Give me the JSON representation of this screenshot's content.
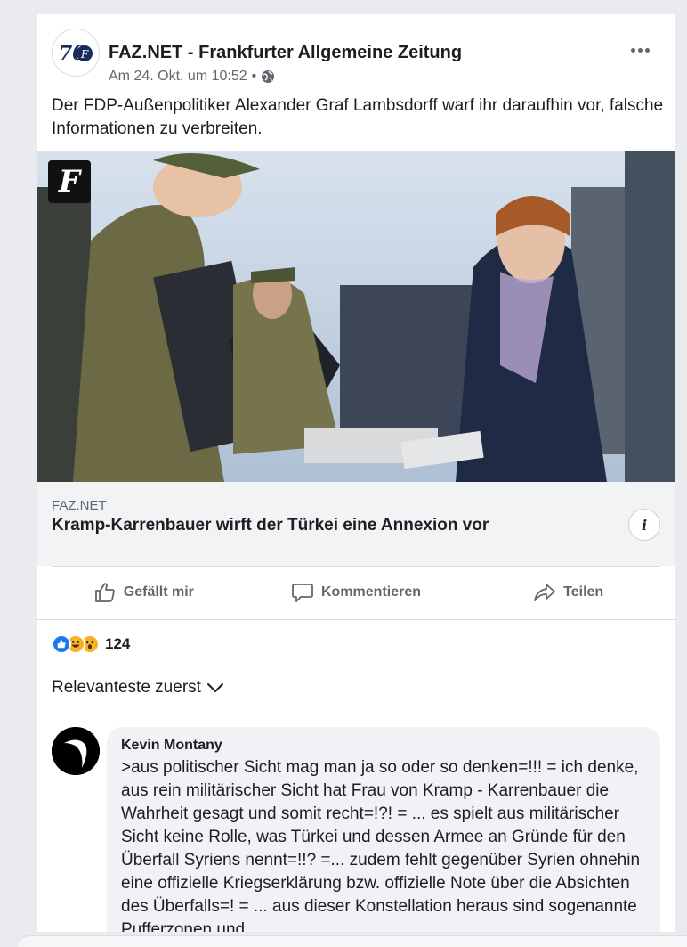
{
  "post": {
    "page_name": "FAZ.NET - Frankfurter Allgemeine Zeitung",
    "timestamp": "Am 24. Okt. um 10:52",
    "separator": "•",
    "audience_icon": "globe-icon",
    "avatar_text": "70",
    "more_icon": "more-options-icon",
    "text": "Der FDP-Außenpolitiker Alexander Graf Lambsdorff warf ihr daraufhin vor, falsche Informationen zu verbreiten."
  },
  "link_preview": {
    "logo_letter": "F",
    "domain": "FAZ.NET",
    "title": "Kramp-Karrenbauer wirft der Türkei eine Annexion vor",
    "info_label": "i"
  },
  "actions": {
    "like": "Gefällt mir",
    "comment": "Kommentieren",
    "share": "Teilen"
  },
  "reactions": {
    "types": [
      "like",
      "haha",
      "wow"
    ],
    "count": "124"
  },
  "sort": {
    "label": "Relevanteste zuerst"
  },
  "comment": {
    "author": "Kevin Montany",
    "text": ">aus politischer Sicht mag man ja so oder so denken=!!! = ich denke, aus rein militärischer Sicht hat Frau von Kramp - Karrenbauer die Wahrheit gesagt und somit recht=!?! = ... es spielt aus militärischer Sicht keine Rolle, was Türkei und dessen Armee an Gründe für den Überfall  Syriens nennt=!!? =... zudem fehlt gegenüber Syrien ohnehin eine offizielle Kriegserklärung bzw. offizielle  Note über die Absichten des Überfalls=! = ... aus dieser Konstellation heraus sind sogenannte Pufferzonen und"
  },
  "colors": {
    "accent": "#1877f2",
    "secondary_text": "#606770",
    "background": "#e9ebee"
  }
}
